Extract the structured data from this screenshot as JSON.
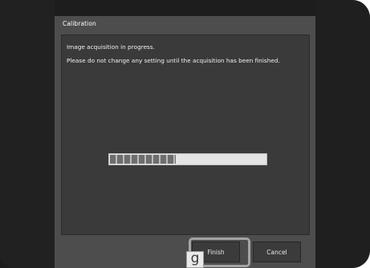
{
  "dialog": {
    "title": "Calibration",
    "message_line1": "Image acquisition in progress.",
    "message_line2": "Please do not change any setting until the acquisition has been finished."
  },
  "progress": {
    "fraction": 0.43,
    "fill_color": "#6e6e6e",
    "track_color": "#e4e4e4"
  },
  "buttons": {
    "finish_label": "Finish",
    "cancel_label": "Cancel"
  },
  "callout": {
    "label": "g"
  }
}
